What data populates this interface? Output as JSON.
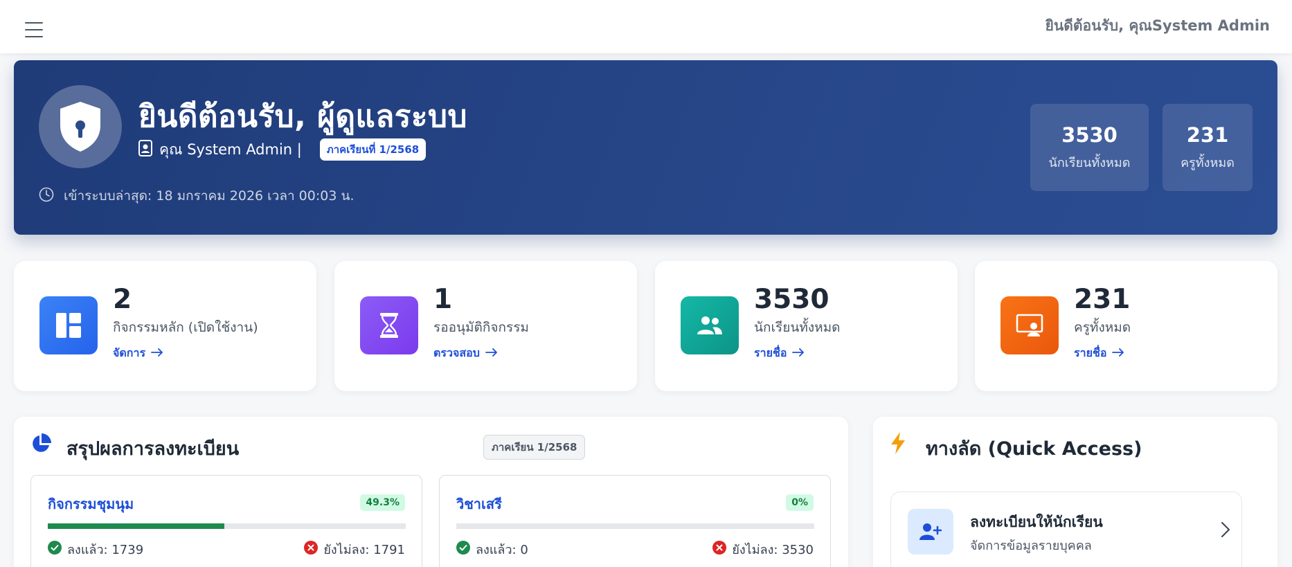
{
  "topbar": {
    "welcome_text": "ยินดีต้อนรับ, คุณSystem Admin"
  },
  "hero": {
    "title": "ยินดีต้อนรับ, ผู้ดูแลระบบ",
    "user_name": "คุณ System Admin |",
    "term_badge": "ภาคเรียนที่ 1/2568",
    "last_login": "เข้าระบบล่าสุด: 18 มกราคม 2026 เวลา 00:03 น.",
    "stats": [
      {
        "value": "3530",
        "label": "นักเรียนทั้งหมด"
      },
      {
        "value": "231",
        "label": "ครูทั้งหมด"
      }
    ]
  },
  "cards": [
    {
      "value": "2",
      "label": "กิจกรรมหลัก (เปิดใช้งาน)",
      "link": "จัดการ",
      "icon": "dashboard-icon",
      "color": "#2563eb"
    },
    {
      "value": "1",
      "label": "รออนุมัติกิจกรรม",
      "link": "ตรวจสอบ",
      "icon": "hourglass-icon",
      "color": "#7c3aed"
    },
    {
      "value": "3530",
      "label": "นักเรียนทั้งหมด",
      "link": "รายชื่อ",
      "icon": "people-icon",
      "color": "#0d9488"
    },
    {
      "value": "231",
      "label": "ครูทั้งหมด",
      "link": "รายชื่อ",
      "icon": "teacher-icon",
      "color": "#ea580c"
    }
  ],
  "summary": {
    "title": "สรุปผลการลงทะเบียน",
    "term": "ภาคเรียน 1/2568",
    "groups": [
      {
        "name": "กิจกรรมชุมนุม",
        "percent_label": "49.3%",
        "percent": 49.3,
        "registered": "ลงแล้ว: 1739",
        "not_registered": "ยังไม่ลง: 1791"
      },
      {
        "name": "วิชาเสรี",
        "percent_label": "0%",
        "percent": 0,
        "registered": "ลงแล้ว: 0",
        "not_registered": "ยังไม่ลง: 3530"
      }
    ]
  },
  "quick": {
    "title": "ทางลัด (Quick Access)",
    "items": [
      {
        "title": "ลงทะเบียนให้นักเรียน",
        "subtitle": "จัดการข้อมูลรายบุคคล"
      }
    ]
  },
  "colors": {
    "accent": "#1d4ed8",
    "success": "#1e8a4e",
    "danger": "#dc2626",
    "hero": "#1f3b78"
  }
}
